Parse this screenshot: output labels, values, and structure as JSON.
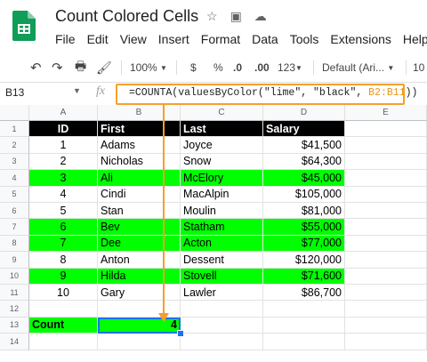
{
  "app": {
    "doc_title": "Count Colored Cells",
    "menu": [
      "File",
      "Edit",
      "View",
      "Insert",
      "Format",
      "Data",
      "Tools",
      "Extensions",
      "Help"
    ]
  },
  "toolbar": {
    "zoom": "100%",
    "currency": "$",
    "percent": "%",
    "dec_decrease": ".0",
    "dec_increase": ".00",
    "format_more": "123",
    "font": "Default (Ari...",
    "font_size": "10"
  },
  "formula_bar": {
    "name_box": "B13",
    "fx": "fx",
    "formula_prefix": "=COUNTA(valuesByColor(\"lime\", \"black\", ",
    "formula_range": "B2:B11",
    "formula_suffix": "))"
  },
  "columns": [
    "A",
    "B",
    "C",
    "D",
    "E"
  ],
  "rows": [
    "1",
    "2",
    "3",
    "4",
    "5",
    "6",
    "7",
    "8",
    "9",
    "10",
    "11",
    "12",
    "13",
    "14"
  ],
  "header_row": {
    "id": "ID",
    "first": "First",
    "last": "Last",
    "salary": "Salary"
  },
  "data_rows": [
    {
      "id": "1",
      "first": "Adams",
      "last": "Joyce",
      "salary": "$41,500",
      "lime": false
    },
    {
      "id": "2",
      "first": "Nicholas",
      "last": "Snow",
      "salary": "$64,300",
      "lime": false
    },
    {
      "id": "3",
      "first": "Ali",
      "last": "McElory",
      "salary": "$45,000",
      "lime": true
    },
    {
      "id": "4",
      "first": "Cindi",
      "last": "MacAlpin",
      "salary": "$105,000",
      "lime": false
    },
    {
      "id": "5",
      "first": "Stan",
      "last": "Moulin",
      "salary": "$81,000",
      "lime": false
    },
    {
      "id": "6",
      "first": "Bev",
      "last": "Statham",
      "salary": "$55,000",
      "lime": true
    },
    {
      "id": "7",
      "first": "Dee",
      "last": "Acton",
      "salary": "$77,000",
      "lime": true
    },
    {
      "id": "8",
      "first": "Anton",
      "last": "Dessent",
      "salary": "$120,000",
      "lime": false
    },
    {
      "id": "9",
      "first": "Hilda",
      "last": "Stovell",
      "salary": "$71,600",
      "lime": true
    },
    {
      "id": "10",
      "first": "Gary",
      "last": "Lawler",
      "salary": "$86,700",
      "lime": false
    }
  ],
  "count_row": {
    "label": "Count",
    "value": "4"
  },
  "colors": {
    "lime": "#00ff00",
    "header_bg": "#000000",
    "callout": "#f4a02b",
    "selection": "#1a73e8"
  }
}
